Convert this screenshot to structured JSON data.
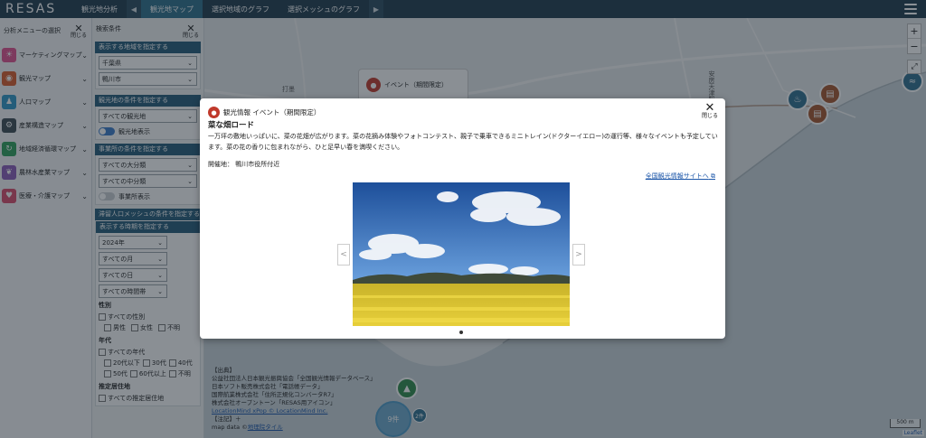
{
  "topbar": {
    "brand": "RESAS",
    "tabs": [
      {
        "label": "観光地分析"
      },
      {
        "label": "観光地マップ"
      },
      {
        "label": "選択地域のグラフ"
      },
      {
        "label": "選択メッシュのグラフ"
      }
    ]
  },
  "menu": {
    "title": "分析メニューの選択",
    "close": "閉じる",
    "items": [
      {
        "label": "マーケティングマップ",
        "color": "#e0508f"
      },
      {
        "label": "観光マップ",
        "color": "#d85a2a"
      },
      {
        "label": "人口マップ",
        "color": "#2f97c7"
      },
      {
        "label": "産業構造マップ",
        "color": "#3d4a52"
      },
      {
        "label": "地域経済循環マップ",
        "color": "#2f9e5a"
      },
      {
        "label": "農林水産業マップ",
        "color": "#8a5bb8"
      },
      {
        "label": "医療・介護マップ",
        "color": "#d94a6a"
      }
    ]
  },
  "search": {
    "title": "検索条件",
    "close": "閉じる",
    "region": {
      "header": "表示する地域を指定する",
      "prefecture": "千葉県",
      "city": "鴨川市"
    },
    "spot": {
      "header": "観光地の条件を指定する",
      "select": "すべての観光地",
      "toggle": "観光地表示"
    },
    "office": {
      "header": "事業所の条件を指定する",
      "major": "すべての大分類",
      "middle": "すべての中分類",
      "toggle": "事業所表示"
    },
    "mesh": {
      "header": "滞留人口メッシュの条件を指定する",
      "period_label": "表示する時期を指定する",
      "year": "2024年",
      "month": "すべての月",
      "day": "すべての日",
      "time": "すべての時間帯",
      "gender_label": "性別",
      "gender_all": "すべての性別",
      "gender_opts": [
        "男性",
        "女性",
        "不明"
      ],
      "age_label": "年代",
      "age_all": "すべての年代",
      "age_opts_1": [
        "20代以下",
        "30代",
        "40代"
      ],
      "age_opts_2": [
        "50代",
        "60代以上",
        "不明"
      ],
      "residence_label": "推定居住地",
      "residence_all": "すべての推定居住地"
    }
  },
  "map": {
    "behind_popup": "イベント（期間限定）",
    "labels": [
      "打墨",
      "安房天津駅"
    ],
    "cluster": "9件",
    "cluster_small": "2件",
    "scale": "500 m",
    "attribution": "Leaflet",
    "sources": {
      "head": "【出典】",
      "lines": [
        "公益社団法人日本観光振興協会「全国観光情報データベース」",
        "日本ソフト販売株式会社「電話帳データ」",
        "国際航業株式会社「住所正規化コンバータR7」",
        "株式会社オープントーン「RESAS用アイコン」"
      ],
      "link": "LocationMind xPop © LocationMind Inc.",
      "note": "【注記】＋",
      "mapdata_prefix": "map data ©",
      "mapdata_link": "地理院タイル"
    }
  },
  "modal": {
    "category": "観光情報 イベント（期間限定）",
    "close": "閉じる",
    "title": "菜な畑ロード",
    "description": "一万坪の敷地いっぱいに、菜の花畑が広がります。菜の花摘み体験やフォトコンテスト、親子で乗車できるミニトレイン(ドクターイエロー)の運行等、様々なイベントも予定しています。菜の花の香りに包まれながら、ひと足早い春を満喫ください。",
    "venue": "開催地： 鴨川市役所付近",
    "link": "全国観光情報サイトへ",
    "prev": "<",
    "next": ">",
    "image_alt": "blue-sky-rapeseed-field-photo"
  }
}
